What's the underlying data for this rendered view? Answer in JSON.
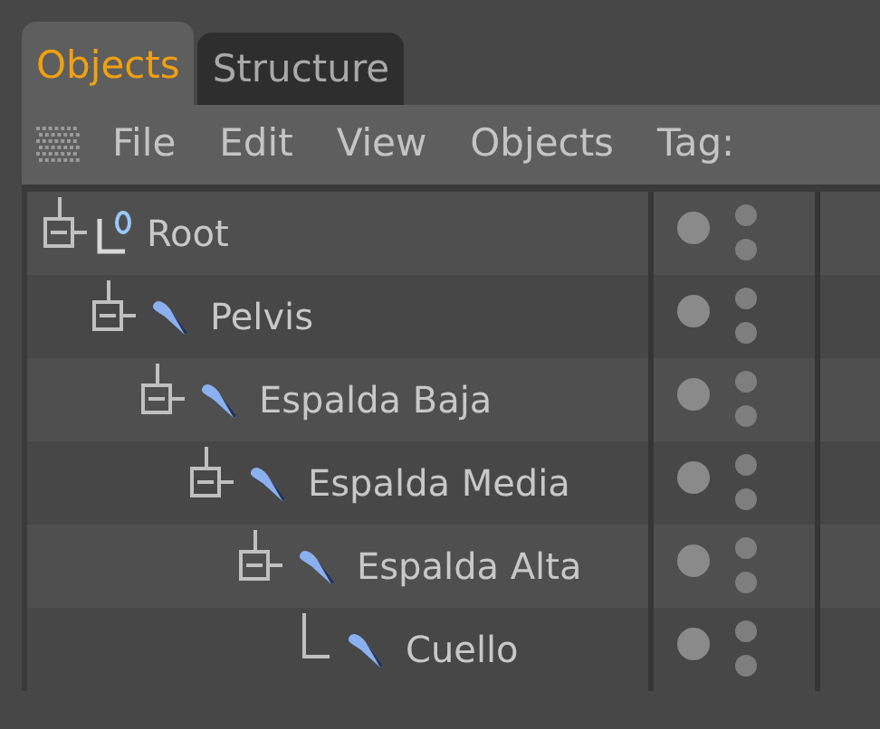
{
  "tabs": [
    {
      "label": "Objects",
      "selected": true
    },
    {
      "label": "Structure",
      "selected": false
    }
  ],
  "menu": [
    "File",
    "Edit",
    "View",
    "Objects",
    "Tag:"
  ],
  "tree": [
    {
      "name": "Root",
      "kind": "null",
      "expanded": true,
      "children": [
        {
          "name": "Pelvis",
          "kind": "bone",
          "expanded": true,
          "children": [
            {
              "name": "Espalda  Baja",
              "kind": "bone",
              "expanded": true,
              "children": [
                {
                  "name": "Espalda Media",
                  "kind": "bone",
                  "expanded": true,
                  "children": [
                    {
                      "name": "Espalda Alta",
                      "kind": "bone",
                      "expanded": true,
                      "children": [
                        {
                          "name": "Cuello",
                          "kind": "bone",
                          "expanded": false
                        }
                      ]
                    }
                  ]
                }
              ]
            }
          ]
        }
      ]
    }
  ]
}
